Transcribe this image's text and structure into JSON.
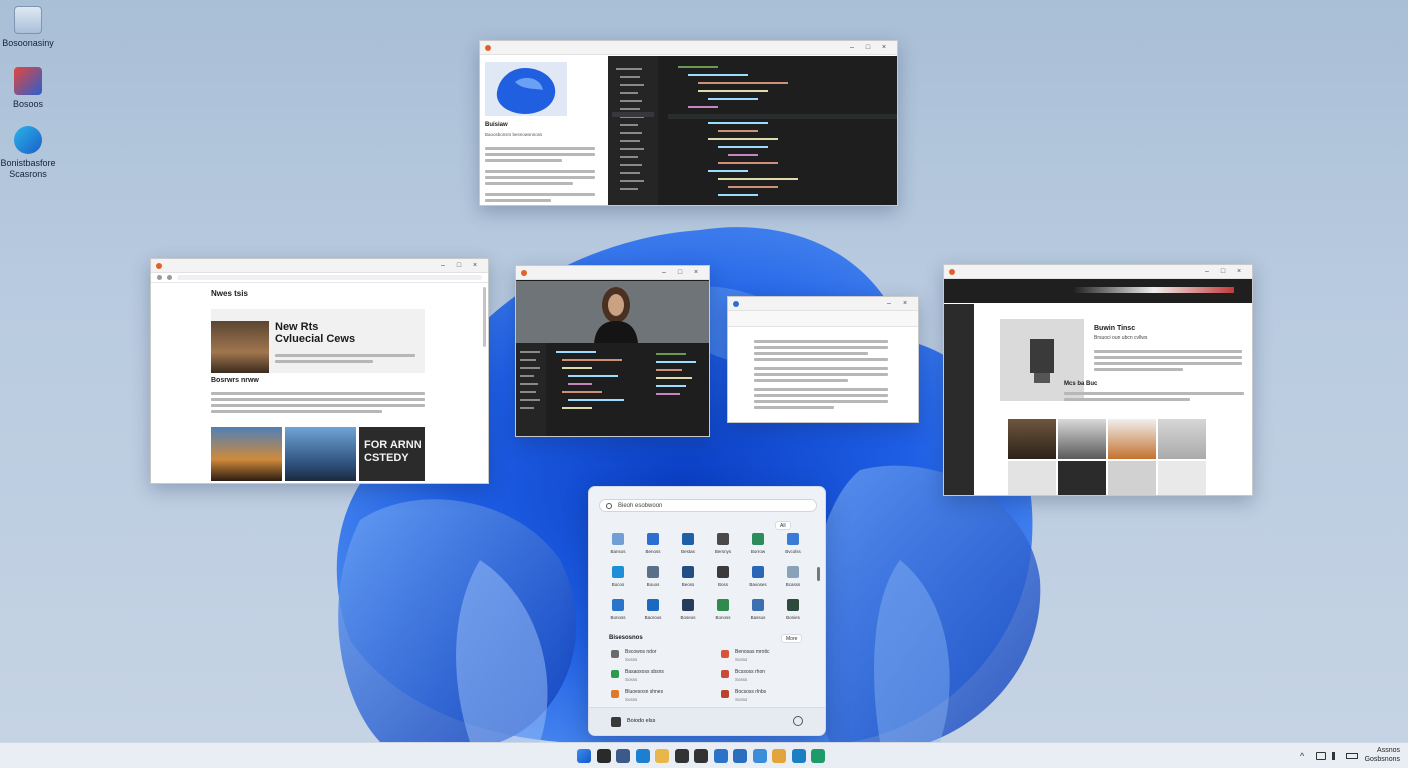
{
  "desktop": {
    "icons": [
      {
        "label": "Bosoonasiny"
      },
      {
        "label": "Bosoos"
      },
      {
        "label": "Bonistbasfore Scasrons"
      }
    ]
  },
  "windows": {
    "editor": {
      "preview_title": "Buisiaw",
      "preview_subtitle": "Baoosbonsrs besnowsnnoss"
    },
    "news": {
      "brand": "Nwes tsis",
      "headline_1": "New Rts",
      "headline_2": "Cvluecial Cews",
      "section": "Bosrwrs nrww",
      "tile_text_1": "FOR ARNN",
      "tile_text_2": "CSTEDY"
    },
    "shop": {
      "product_title": "Buwin Tinsc",
      "product_subtitle": "Brsuoci oun ubcn cvllws",
      "section": "Mcs ba Buc"
    }
  },
  "start_menu": {
    "search_placeholder": "Bieoh esobwoon",
    "pinned_all_label": "All",
    "pinned_apps": [
      {
        "label": "Bansos",
        "color": "#6f9fd4"
      },
      {
        "label": "Benoss",
        "color": "#2b6fd1"
      },
      {
        "label": "Bestas",
        "color": "#1f5fa8"
      },
      {
        "label": "Bersnys",
        "color": "#4a4a4a"
      },
      {
        "label": "Borrow",
        "color": "#2c8c5a"
      },
      {
        "label": "Bvcolss",
        "color": "#3a7bd5"
      },
      {
        "label": "Bocos",
        "color": "#1d8fd8"
      },
      {
        "label": "Bouos",
        "color": "#5b6f88"
      },
      {
        "label": "Beoss",
        "color": "#224d85"
      },
      {
        "label": "Boss",
        "color": "#3b3b3b"
      },
      {
        "label": "Bavoses",
        "color": "#2866b8"
      },
      {
        "label": "Bcasss",
        "color": "#8aa1ba"
      },
      {
        "label": "Bonoss",
        "color": "#2a74c9"
      },
      {
        "label": "Baoroos",
        "color": "#1b6ac0"
      },
      {
        "label": "Boseos",
        "color": "#263c5a"
      },
      {
        "label": "Bonoss",
        "color": "#2f8a4e"
      },
      {
        "label": "Bassus",
        "color": "#3a6fb0"
      },
      {
        "label": "Bonies",
        "color": "#2e4a3c"
      }
    ],
    "recommended_label": "Bisesosnos",
    "more_label": "More",
    "recommended": [
      {
        "title": "Bscowos ndor",
        "sub": "Sosss",
        "color": "#6b6b6b"
      },
      {
        "title": "Benosas mrotic",
        "sub": "Sosss",
        "color": "#d8533a"
      },
      {
        "title": "Basaososs sbsns",
        "sub": "Sosss",
        "color": "#2d9a4d"
      },
      {
        "title": "Bcssoss rhon",
        "sub": "Sosss",
        "color": "#c94a3b"
      },
      {
        "title": "Bluoesosn shnes",
        "sub": "Sosss",
        "color": "#e07a2a"
      },
      {
        "title": "Bocsoss rlnbs",
        "sub": "Sosss",
        "color": "#b8442f"
      }
    ],
    "user_name": "Boiodo elss"
  },
  "taskbar": {
    "apps": [
      {
        "name": "start-icon",
        "color": "#1f6fd6"
      },
      {
        "name": "search-icon",
        "color": "#2a2a2a"
      },
      {
        "name": "copilot-icon",
        "color": "#3b5a8a"
      },
      {
        "name": "edge-icon",
        "color": "#1d7fd0"
      },
      {
        "name": "folder-icon",
        "color": "#e8b64a"
      },
      {
        "name": "search-app-icon",
        "color": "#333333"
      },
      {
        "name": "chat-icon",
        "color": "#333333"
      },
      {
        "name": "store-icon",
        "color": "#2b73c9"
      },
      {
        "name": "mail-icon",
        "color": "#2a6fbf"
      },
      {
        "name": "photos-icon",
        "color": "#3c8dd9"
      },
      {
        "name": "files-icon",
        "color": "#e2a53b"
      },
      {
        "name": "edge2-icon",
        "color": "#1b7fc4"
      },
      {
        "name": "browser-icon",
        "color": "#1f9a6a"
      }
    ],
    "clock_time": "Assnos",
    "clock_date": "Gosbsnons"
  }
}
